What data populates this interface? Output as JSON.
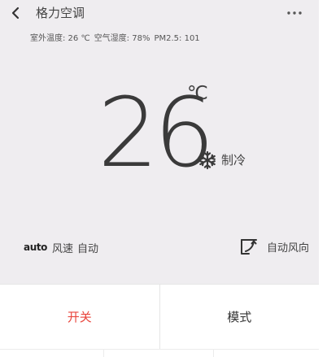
{
  "header": {
    "title": "格力空调",
    "back_icon": "chevron-left-icon",
    "more_icon": "more-dots-icon"
  },
  "environment": {
    "outdoor_temp": "室外温度: 26 ℃",
    "humidity": "空气湿度: 78%",
    "pm25": "PM2.5: 101"
  },
  "status": {
    "temperature": "26",
    "unit": "℃",
    "mode_icon": "snowflake-icon",
    "mode_label": "制冷"
  },
  "fan": {
    "badge": "auto",
    "label": "风速",
    "value": "自动"
  },
  "wind_direction": {
    "icon": "swing-direction-icon",
    "label": "自动风向"
  },
  "controls": {
    "power_label": "开关",
    "mode_label": "模式"
  },
  "colors": {
    "background": "#efedf0",
    "power_accent": "#e8453c",
    "text": "#333333"
  }
}
